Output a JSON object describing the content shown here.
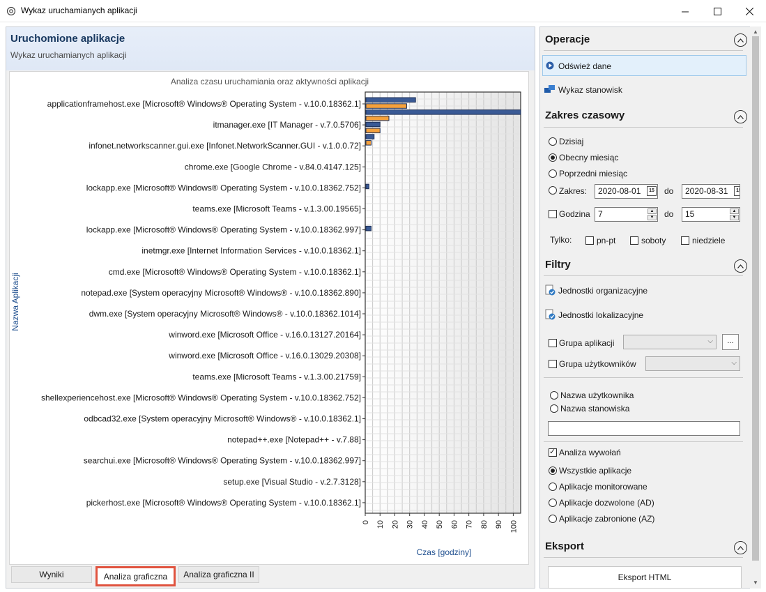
{
  "window": {
    "title": "Wykaz uruchamianych aplikacji"
  },
  "left_panel": {
    "title": "Uruchomione aplikacje",
    "subtitle": "Wykaz uruchamianych aplikacji"
  },
  "chart_data": {
    "type": "bar",
    "orientation": "horizontal",
    "title": "Analiza czasu uruchamiania oraz aktywności aplikacji",
    "xlabel": "Czas [godziny]",
    "ylabel": "Nazwa Aplikacji",
    "xlim": [
      0,
      105
    ],
    "x_ticks": [
      0,
      10,
      20,
      30,
      40,
      50,
      60,
      70,
      80,
      90,
      100
    ],
    "colors": [
      "#3a5a95",
      "#f5a13c"
    ],
    "grid": true,
    "categories": [
      "applicationframehost.exe [Microsoft® Windows® Operating System - v.10.0.18362.1]",
      "itmanager.exe [IT Manager - v.7.0.5706]",
      "infonet.networkscanner.gui.exe [Infonet.NetworkScanner.GUI - v.1.0.0.72]",
      "chrome.exe [Google Chrome - v.84.0.4147.125]",
      "lockapp.exe [Microsoft® Windows® Operating System - v.10.0.18362.752]",
      "teams.exe [Microsoft Teams - v.1.3.00.19565]",
      "lockapp.exe [Microsoft® Windows® Operating System - v.10.0.18362.997]",
      "inetmgr.exe [Internet Information Services - v.10.0.18362.1]",
      "cmd.exe [Microsoft® Windows® Operating System - v.10.0.18362.1]",
      "notepad.exe [System operacyjny Microsoft® Windows® - v.10.0.18362.890]",
      "dwm.exe [System operacyjny Microsoft® Windows® - v.10.0.18362.1014]",
      "winword.exe [Microsoft Office - v.16.0.13127.20164]",
      "winword.exe [Microsoft Office - v.16.0.13029.20308]",
      "teams.exe [Microsoft Teams - v.1.3.00.21759]",
      "shellexperiencehost.exe [Microsoft® Windows® Operating System - v.10.0.18362.752]",
      "odbcad32.exe [System operacyjny Microsoft® Windows® - v.10.0.18362.1]",
      "notepad++.exe [Notepad++ - v.7.88]",
      "searchui.exe [Microsoft® Windows® Operating System - v.10.0.18362.997]",
      "setup.exe [Visual Studio - v.2.7.3128]",
      "pickerhost.exe [Microsoft® Windows® Operating System - v.10.0.18362.1]"
    ],
    "bars": [
      {
        "color": "#3a5a95",
        "value": 34
      },
      {
        "color": "#f5a13c",
        "value": 28
      },
      {
        "color": "#3a5a95",
        "value": 105
      },
      {
        "color": "#f5a13c",
        "value": 16
      },
      {
        "color": "#3a5a95",
        "value": 10
      },
      {
        "color": "#f5a13c",
        "value": 10
      },
      {
        "color": "#3a5a95",
        "value": 6
      },
      {
        "color": "#f5a13c",
        "value": 4
      },
      {
        "color": "#3a5a95",
        "value": 2.5,
        "category_index": 4
      },
      {
        "color": "#3a5a95",
        "value": 4,
        "category_index": 6
      }
    ]
  },
  "tabs": {
    "results": "Wyniki",
    "graphic": "Analiza graficzna",
    "graphic2": "Analiza graficzna II"
  },
  "operations": {
    "title": "Operacje",
    "refresh": "Odśwież dane",
    "stations": "Wykaz stanowisk"
  },
  "time_range": {
    "title": "Zakres czasowy",
    "today": "Dzisiaj",
    "current_month": "Obecny miesiąc",
    "previous_month": "Poprzedni miesiąc",
    "range": "Zakres:",
    "date_from": "2020-08-01",
    "to": "do",
    "date_to": "2020-08-31",
    "hour": "Godzina",
    "hour_from": "7",
    "hour_to": "15",
    "only": "Tylko:",
    "weekdays": "pn-pt",
    "saturdays": "soboty",
    "sundays": "niedziele",
    "calendar_glyph": "15"
  },
  "filters": {
    "title": "Filtry",
    "org_units": "Jednostki organizacyjne",
    "loc_units": "Jednostki lokalizacyjne",
    "app_group": "Grupa aplikacji",
    "user_group": "Grupa użytkowników",
    "ellipsis": "...",
    "user_name": "Nazwa użytkownika",
    "station_name": "Nazwa stanowiska",
    "call_analysis": "Analiza wywołań",
    "all_apps": "Wszystkie aplikacje",
    "monitored": "Aplikacje monitorowane",
    "allowed": "Aplikacje dozwolone (AD)",
    "forbidden": "Aplikacje zabronione (AZ)"
  },
  "export": {
    "title": "Eksport",
    "html": "Eksport HTML"
  }
}
